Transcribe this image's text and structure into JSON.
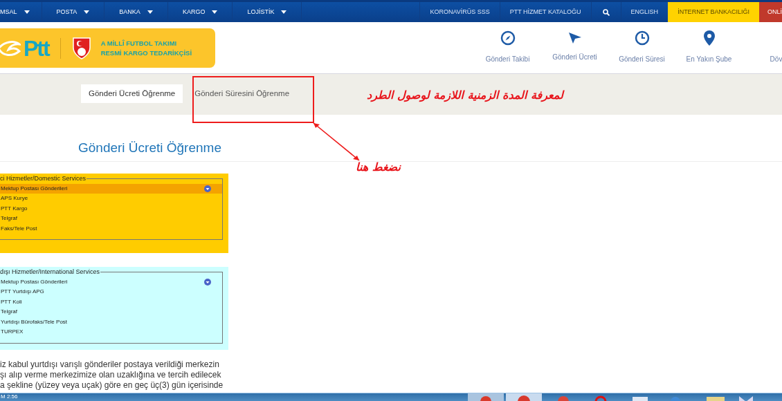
{
  "top_nav": {
    "left_items": [
      {
        "label": "MSAL"
      },
      {
        "label": "POSTA"
      },
      {
        "label": "BANKA"
      },
      {
        "label": "KARGO"
      },
      {
        "label": "LOJİSTİK"
      }
    ],
    "right_items": [
      {
        "kind": "link",
        "label": "KORONAVİRÜS SSS"
      },
      {
        "kind": "link",
        "label": "PTT HİZMET KATALOĞU"
      },
      {
        "kind": "search"
      },
      {
        "kind": "link",
        "label": "ENGLISH"
      },
      {
        "kind": "highlight",
        "label": "İNTERNET BANKACILIĞI"
      },
      {
        "kind": "alert",
        "label": "ONLİ"
      }
    ]
  },
  "logo": {
    "brand": "Ptt",
    "line_1": "A MİLLÎ FUTBOL TAKIMI",
    "line_2": "RESMİ KARGO TEDARİKÇİSİ"
  },
  "quick_links": [
    {
      "label": "Gönderi Takibi"
    },
    {
      "label": "Gönderi Ücreti"
    },
    {
      "label": "Gönderi Süresi"
    },
    {
      "label": "En Yakın Şube"
    },
    {
      "label": "Döv"
    }
  ],
  "tabs": [
    {
      "label": "Gönderi Ücreti Öğrenme",
      "selected": true
    },
    {
      "label": "Gönderi Süresini Öğrenme",
      "selected": false
    }
  ],
  "annotations": {
    "instruction": "لمعرفة المدة الزمنية اللازمة لوصول الطرد",
    "hint": "نضغط هنا"
  },
  "heading": "Gönderi Ücreti Öğrenme",
  "panels": [
    {
      "kind": "domestic",
      "legend": "ci Hizmetler/Domestic Services",
      "items": [
        {
          "label": "Mektup Postası Gönderileri",
          "selected": true
        },
        {
          "label": "APS Kurye",
          "selected": false
        },
        {
          "label": "PTT Kargo",
          "selected": false
        },
        {
          "label": "Telgraf",
          "selected": false
        },
        {
          "label": "Faks/Tele Post",
          "selected": false
        }
      ]
    },
    {
      "kind": "international",
      "legend": "dışı Hizmetler/International Services",
      "items": [
        {
          "label": "Mektup Postası Gönderileri",
          "selected": false
        },
        {
          "label": "PTT Yurtdışı APG",
          "selected": false
        },
        {
          "label": "PTT Koli",
          "selected": false
        },
        {
          "label": "Telgraf",
          "selected": false
        },
        {
          "label": "Yurtdışı Bürofaks/Tele Post",
          "selected": false
        },
        {
          "label": "TURPEX",
          "selected": false
        }
      ]
    }
  ],
  "paragraph_lines": [
    "iz kabul yurtdışı varışlı gönderiler postaya verildiği merkezin",
    "şı alıp verme merkezimize olan uzaklığına ve tercih edilecek",
    "a şekline (yüzey veya uçak) göre en geç üç(3) gün içerisinde"
  ],
  "taskbar": {
    "clock": "M 2:56"
  }
}
